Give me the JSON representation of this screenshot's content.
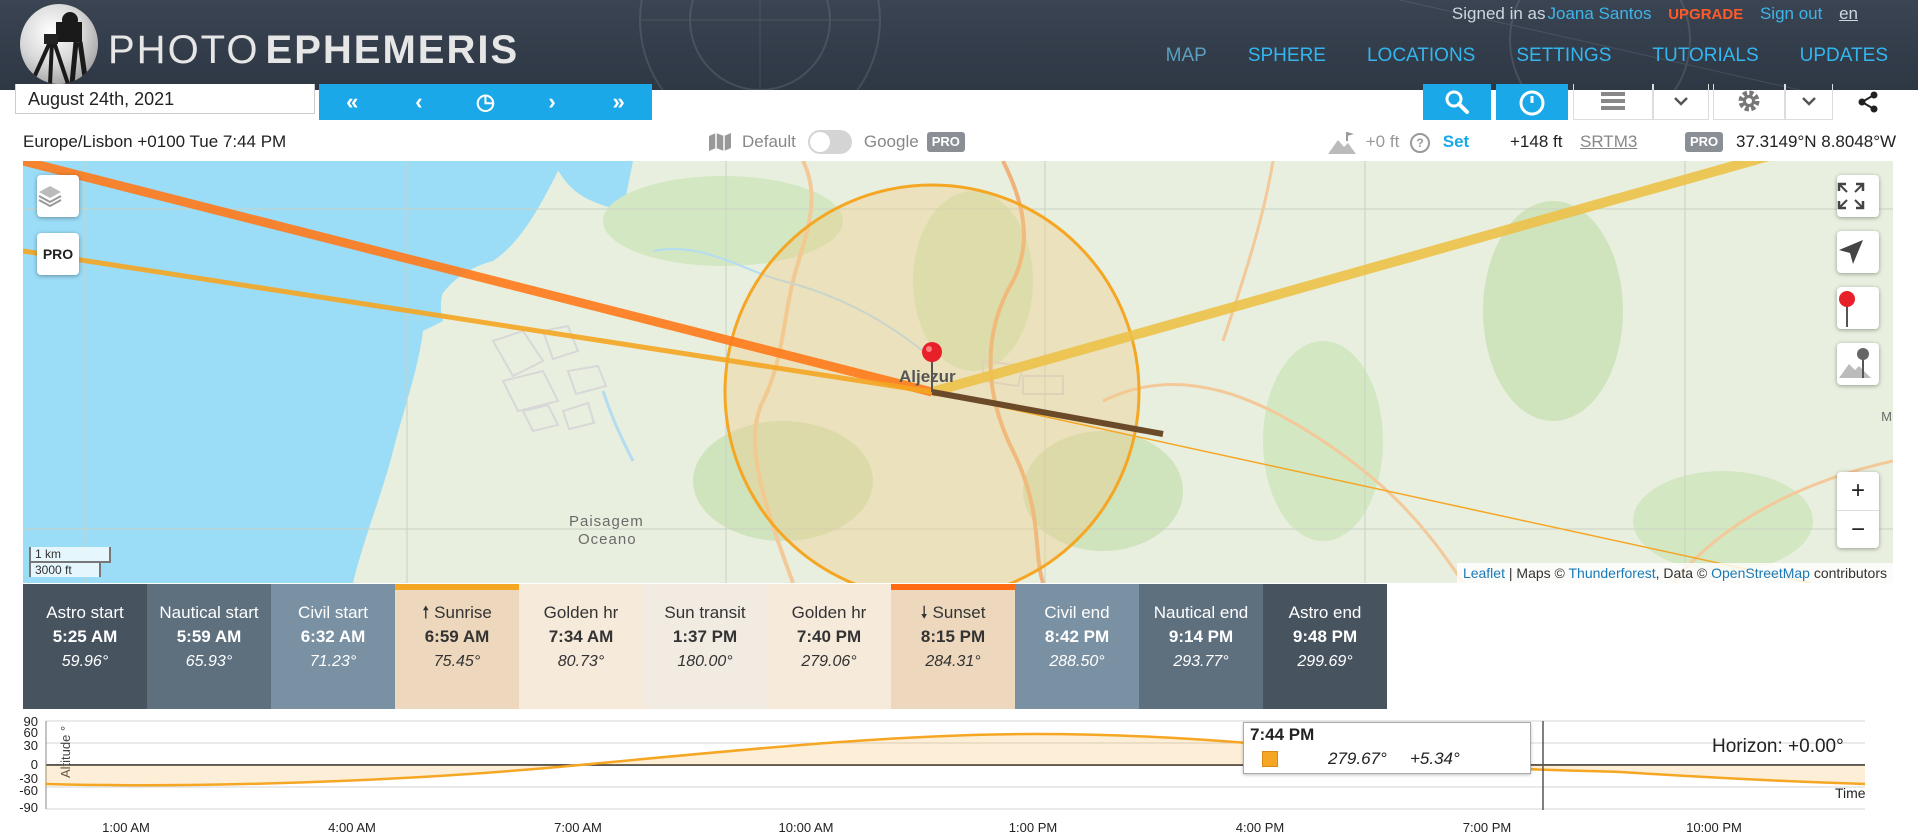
{
  "header": {
    "brand_part1": "PHOTO",
    "brand_part2": "EPHEMERIS",
    "signed_in_prefix": "Signed in as",
    "user_name": "Joana Santos",
    "upgrade": "UPGRADE",
    "sign_out": "Sign out",
    "lang": "en",
    "nav": [
      "MAP",
      "SPHERE",
      "LOCATIONS",
      "SETTINGS",
      "TUTORIALS",
      "UPDATES"
    ]
  },
  "toolbar": {
    "date": "August 24th, 2021",
    "time_nav": [
      "«",
      "‹",
      "◷",
      "›",
      "»"
    ]
  },
  "infobar": {
    "timezone": "Europe/Lisbon +0100 Tue 7:44 PM",
    "map_default": "Default",
    "map_google": "Google",
    "pro": "PRO",
    "elev_offset": "+0 ft",
    "help": "?",
    "set": "Set",
    "elevation": "+148 ft",
    "dem": "SRTM3",
    "coords": "37.3149°N 8.8048°W"
  },
  "map": {
    "pro_button": "PRO",
    "town": "Aljezur",
    "label1": "Paisagem",
    "label2": "Oceano",
    "edge_label": "M",
    "scale_km": "1 km",
    "scale_ft": "3000 ft",
    "attribution_leaflet": "Leaflet",
    "attribution_maps": " | Maps © ",
    "attribution_tf": "Thunderforest",
    "attribution_data": ", Data © ",
    "attribution_osm": "OpenStreetMap",
    "attribution_tail": " contributors",
    "zoom_in": "+",
    "zoom_out": "−"
  },
  "events": [
    {
      "label": "Astro start",
      "time": "5:25 AM",
      "azimuth": "59.96°"
    },
    {
      "label": "Nautical start",
      "time": "5:59 AM",
      "azimuth": "65.93°"
    },
    {
      "label": "Civil start",
      "time": "6:32 AM",
      "azimuth": "71.23°"
    },
    {
      "label": "🠕 Sunrise",
      "time": "6:59 AM",
      "azimuth": "75.45°"
    },
    {
      "label": "Golden hr",
      "time": "7:34 AM",
      "azimuth": "80.73°"
    },
    {
      "label": "Sun transit",
      "time": "1:37 PM",
      "azimuth": "180.00°"
    },
    {
      "label": "Golden hr",
      "time": "7:40 PM",
      "azimuth": "279.06°"
    },
    {
      "label": "🠗 Sunset",
      "time": "8:15 PM",
      "azimuth": "284.31°"
    },
    {
      "label": "Civil end",
      "time": "8:42 PM",
      "azimuth": "288.50°"
    },
    {
      "label": "Nautical end",
      "time": "9:14 PM",
      "azimuth": "293.77°"
    },
    {
      "label": "Astro end",
      "time": "9:48 PM",
      "azimuth": "299.69°"
    }
  ],
  "altitude": {
    "ylabel": "Altitude °",
    "xlabel": "Time",
    "yticks": [
      "90",
      "60",
      "30",
      "0",
      "-30",
      "-60",
      "-90"
    ],
    "xticks": [
      "1:00 AM",
      "4:00 AM",
      "7:00 AM",
      "10:00 AM",
      "1:00 PM",
      "4:00 PM",
      "7:00 PM",
      "10:00 PM"
    ],
    "horizon": "Horizon: +0.00°",
    "tooltip_time": "7:44 PM",
    "tooltip_az": "279.67°",
    "tooltip_alt": "+5.34°",
    "sun_color": "#f5a623"
  },
  "colors": {
    "accent": "#1aa8e8",
    "sunrise_line": "#f5a623",
    "sunset_line": "#ff7a1a",
    "moon_line": "#eec24a",
    "upgrade": "#ff5a2a"
  }
}
